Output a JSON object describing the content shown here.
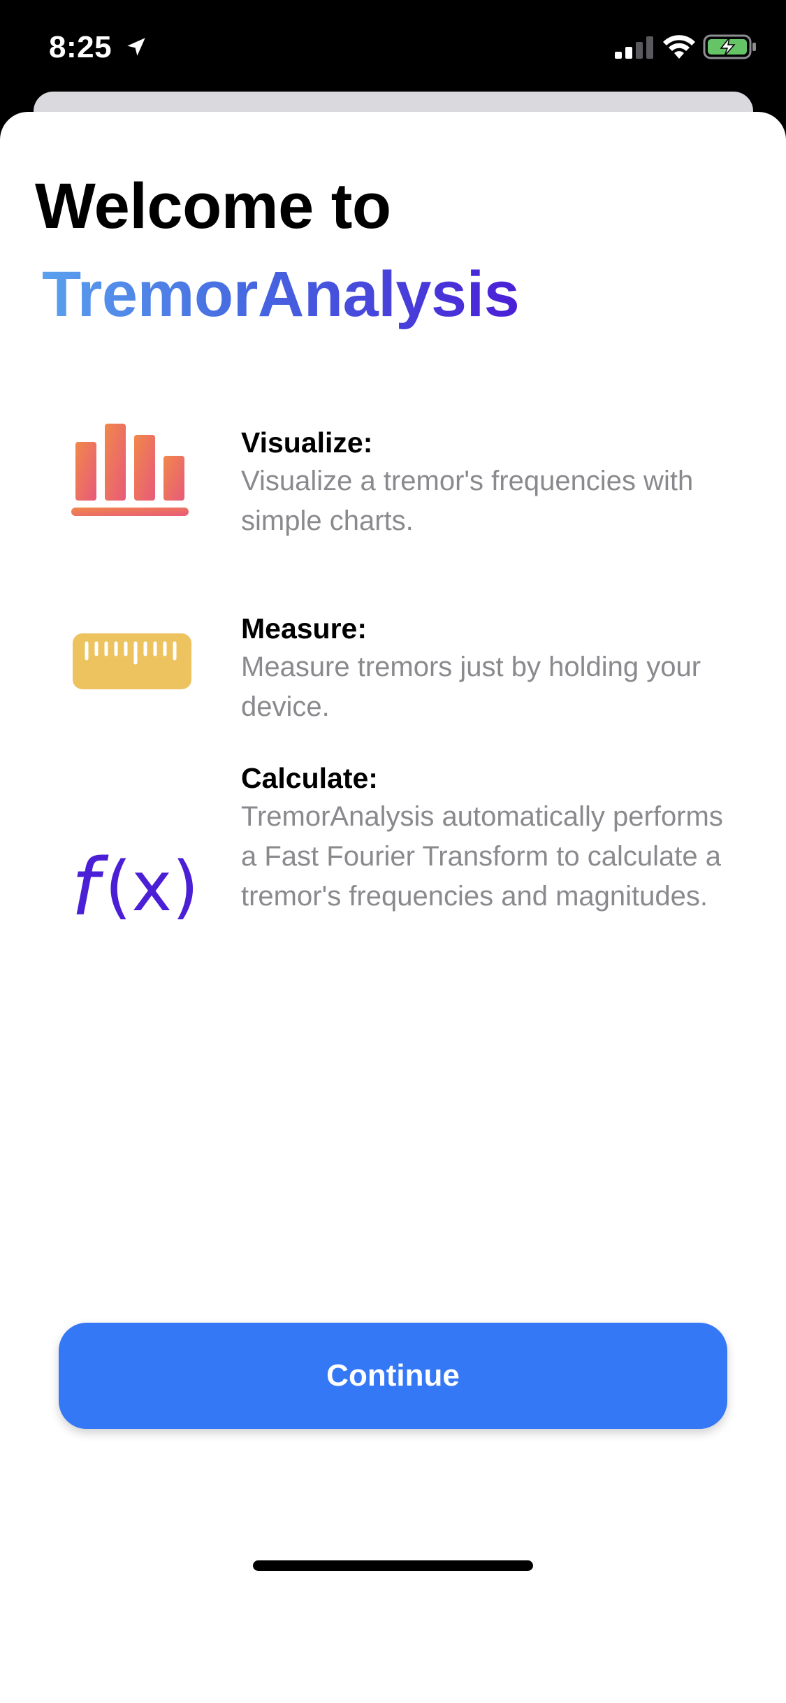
{
  "status_bar": {
    "time": "8:25",
    "location_icon": "location-arrow-icon",
    "signal_icon": "cellular-signal-icon",
    "wifi_icon": "wifi-icon",
    "battery_icon": "battery-charging-icon"
  },
  "header": {
    "welcome": "Welcome to",
    "app_name": "TremorAnalysis"
  },
  "features": [
    {
      "icon": "bar-chart-icon",
      "title": "Visualize:",
      "description": "Visualize a tremor's frequencies with simple charts."
    },
    {
      "icon": "ruler-icon",
      "title": "Measure:",
      "description": "Measure tremors just by holding your device."
    },
    {
      "icon": "function-icon",
      "title": "Calculate:",
      "description": "TremorAnalysis automatically performs a Fast Fourier Transform to calculate a tremor's frequencies and magnitudes."
    }
  ],
  "actions": {
    "continue_label": "Continue"
  },
  "colors": {
    "accent_blue": "#3478f6",
    "gradient_start": "#5aa0ee",
    "gradient_end": "#4a1fd6",
    "chart_orange": "#f0884a",
    "chart_pink": "#e85a7a",
    "ruler_yellow": "#ecc35f",
    "function_purple": "#4a1fd6",
    "battery_green": "#65c466"
  }
}
